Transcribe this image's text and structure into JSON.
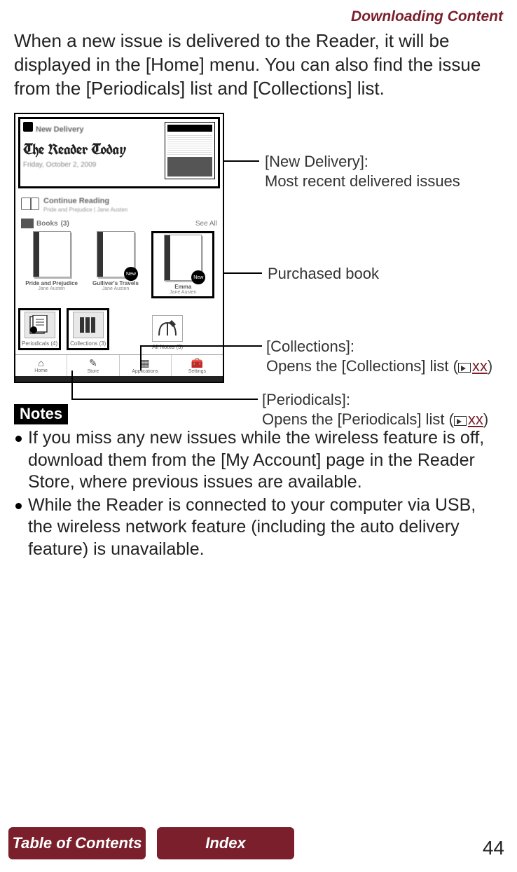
{
  "header": "Downloading Content",
  "intro": "When a new issue is delivered to the Reader, it will be displayed in the [Home] menu. You can also find the issue from the [Periodicals] list and [Collections] list.",
  "device": {
    "new_delivery_label": "New Delivery",
    "masthead": "The Reader Today",
    "masthead_date": "Friday, October 2, 2009",
    "continue_label": "Continue Reading",
    "continue_sub": "Pride and Prejudice | Jane Austen",
    "books_label": "Books",
    "books_count": "(3)",
    "see_all": "See All",
    "books": [
      {
        "title": "Pride and Prejudice",
        "author": "Jane Austen",
        "badge": ""
      },
      {
        "title": "Gulliver's Travels",
        "author": "Jane Austen",
        "badge": "New"
      },
      {
        "title": "Emma",
        "author": "Jane Austen",
        "badge": "New"
      }
    ],
    "bottom": [
      {
        "label": "Periodicals (4)"
      },
      {
        "label": "Collections (3)"
      },
      {
        "label": "All Notes (5)"
      }
    ],
    "toolbar": [
      "Home",
      "Store",
      "Applications",
      "Settings"
    ]
  },
  "callouts": {
    "c1_title": "[New Delivery]:",
    "c1_sub": "Most recent delivered issues",
    "c2": "Purchased book",
    "c3_title": "[Collections]:",
    "c3_sub_pre": "Opens the [Collections] list (",
    "c3_xx": "xx",
    "c3_sub_post": ")",
    "c4_title": "[Periodicals]:",
    "c4_sub_pre": "Opens the [Periodicals] list (",
    "c4_xx": "xx",
    "c4_sub_post": ")"
  },
  "notes_label": "Notes",
  "notes": [
    "If you miss any new issues while the wireless feature is off, download them from the [My Account] page in the Reader Store, where previous issues are available.",
    "While the Reader is connected to your computer via USB, the wireless network feature (including the auto delivery feature) is unavailable."
  ],
  "footer": {
    "toc": "Table of Contents",
    "index": "Index",
    "page": "44"
  }
}
